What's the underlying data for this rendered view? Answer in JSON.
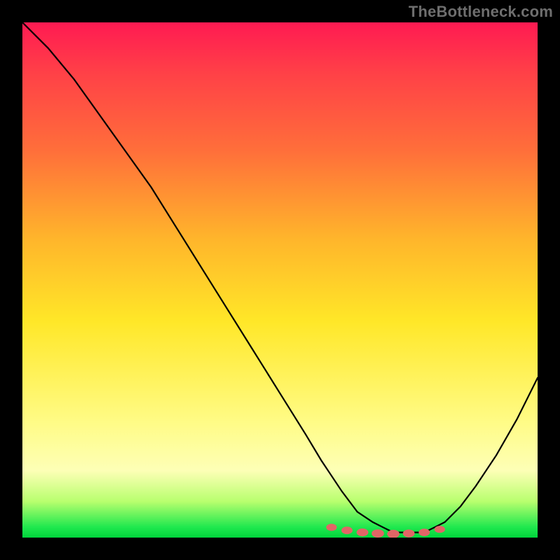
{
  "attribution": "TheBottleneck.com",
  "chart_data": {
    "type": "line",
    "title": "",
    "xlabel": "",
    "ylabel": "",
    "x_range": [
      0,
      100
    ],
    "y_range": [
      0,
      100
    ],
    "series": [
      {
        "name": "bottleneck-curve",
        "x": [
          0,
          5,
          10,
          15,
          20,
          25,
          30,
          35,
          40,
          45,
          50,
          55,
          58,
          60,
          62,
          65,
          68,
          70,
          72,
          75,
          78,
          80,
          82,
          85,
          88,
          92,
          96,
          100
        ],
        "y": [
          100,
          95,
          89,
          82,
          75,
          68,
          60,
          52,
          44,
          36,
          28,
          20,
          15,
          12,
          9,
          5,
          3,
          2,
          1,
          1,
          1,
          2,
          3,
          6,
          10,
          16,
          23,
          31
        ]
      }
    ],
    "markers": {
      "name": "optimal-range-dots",
      "x": [
        60,
        63,
        66,
        69,
        72,
        75,
        78,
        81
      ],
      "y": [
        2,
        1.4,
        1.0,
        0.8,
        0.7,
        0.8,
        1.0,
        1.6
      ]
    },
    "gradient_stops": [
      {
        "pos": 0.0,
        "color": "#ff1a52"
      },
      {
        "pos": 0.5,
        "color": "#ffe728"
      },
      {
        "pos": 0.9,
        "color": "#fdffb6"
      },
      {
        "pos": 1.0,
        "color": "#00d63c"
      }
    ]
  }
}
